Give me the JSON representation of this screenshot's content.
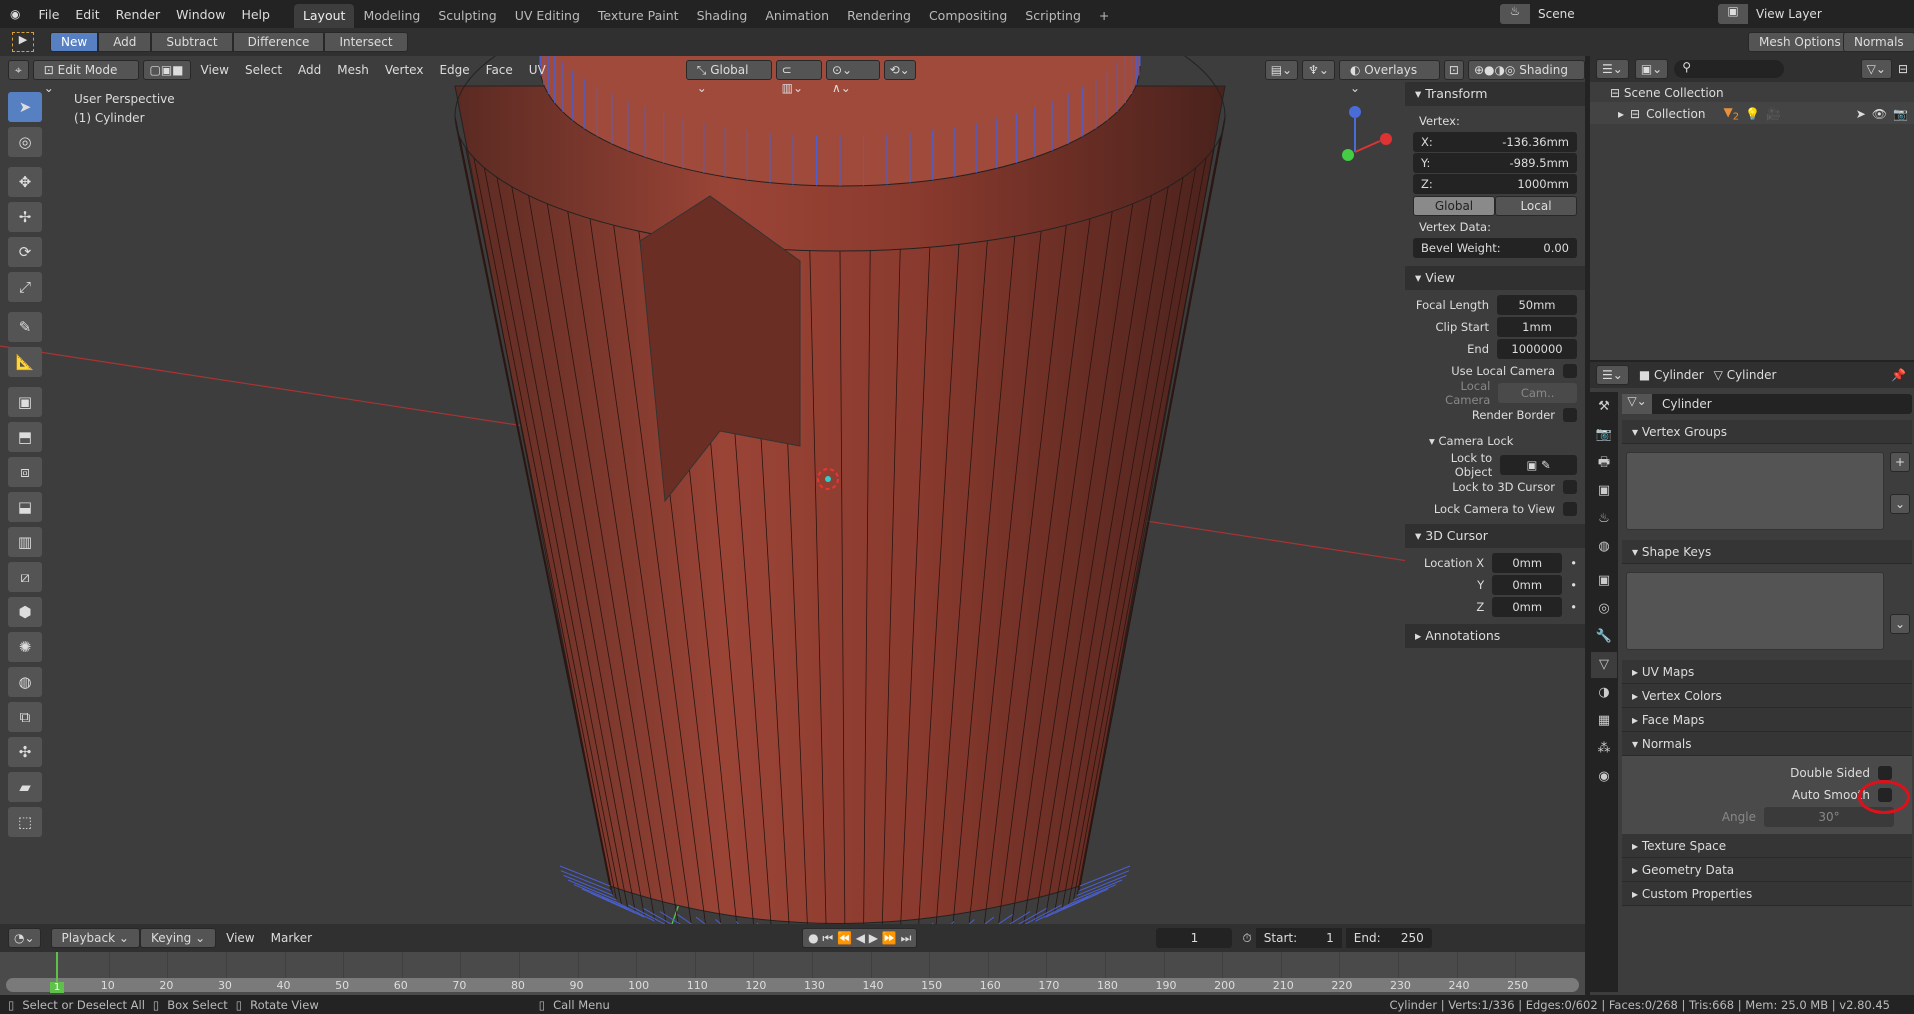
{
  "topbar": {
    "menus": [
      "File",
      "Edit",
      "Render",
      "Window",
      "Help"
    ],
    "workspaces": [
      "Layout",
      "Modeling",
      "Sculpting",
      "UV Editing",
      "Texture Paint",
      "Shading",
      "Animation",
      "Rendering",
      "Compositing",
      "Scripting"
    ],
    "active_workspace": "Layout",
    "add_workspace": "+",
    "scene": "Scene",
    "view_layer": "View Layer"
  },
  "toolbar": {
    "modes": [
      "New",
      "Add",
      "Subtract",
      "Difference",
      "Intersect"
    ],
    "active_mode": "New",
    "mesh_options": "Mesh Options",
    "normals": "Normals"
  },
  "viewport_header": {
    "mode": "Edit Mode",
    "menus": [
      "View",
      "Select",
      "Add",
      "Mesh",
      "Vertex",
      "Edge",
      "Face",
      "UV"
    ],
    "orientation": "Global",
    "overlays": "Overlays",
    "shading": "Shading"
  },
  "viewport": {
    "perspective": "User Perspective",
    "object": "(1) Cylinder",
    "mesh_color": "#8a3a2e",
    "normal_color": "#4a5fd0"
  },
  "npanel": {
    "transform": {
      "title": "Transform",
      "vertex_label": "Vertex:",
      "x_label": "X:",
      "x": "-136.36mm",
      "y_label": "Y:",
      "y": "-989.5mm",
      "z_label": "Z:",
      "z": "1000mm",
      "global": "Global",
      "local": "Local",
      "vertex_data": "Vertex Data:",
      "bevel_label": "Bevel Weight:",
      "bevel": "0.00"
    },
    "view": {
      "title": "View",
      "focal_label": "Focal Length",
      "focal": "50mm",
      "clip_start_label": "Clip Start",
      "clip_start": "1mm",
      "end_label": "End",
      "end": "1000000",
      "use_local_camera": "Use Local Camera",
      "local_camera": "Local Camera",
      "local_camera_value": "Cam..",
      "render_border": "Render Border",
      "camera_lock": "Camera Lock",
      "lock_object": "Lock to Object",
      "lock_cursor": "Lock to 3D Cursor",
      "lock_view": "Lock Camera to View"
    },
    "cursor": {
      "title": "3D Cursor",
      "loc_x_label": "Location X",
      "loc_x": "0mm",
      "y_label": "Y",
      "y": "0mm",
      "z_label": "Z",
      "z": "0mm"
    },
    "annotations": "Annotations"
  },
  "outliner": {
    "scene_collection": "Scene Collection",
    "collection": "Collection",
    "badge": "2"
  },
  "properties": {
    "breadcrumb_object": "Cylinder",
    "breadcrumb_mesh": "Cylinder",
    "mesh_name": "Cylinder",
    "sections": {
      "vertex_groups": "Vertex Groups",
      "shape_keys": "Shape Keys",
      "uv_maps": "UV Maps",
      "vertex_colors": "Vertex Colors",
      "face_maps": "Face Maps",
      "normals": "Normals",
      "texture_space": "Texture Space",
      "geometry_data": "Geometry Data",
      "custom_properties": "Custom Properties"
    },
    "double_sided": "Double Sided",
    "auto_smooth": "Auto Smooth",
    "angle_label": "Angle",
    "angle": "30°",
    "annotation_color": "#e0101a"
  },
  "timeline": {
    "menus": [
      "Playback",
      "Keying",
      "View",
      "Marker"
    ],
    "current_frame": "1",
    "start_label": "Start:",
    "start": "1",
    "end_label": "End:",
    "end": "250",
    "ticks": [
      "10",
      "20",
      "30",
      "40",
      "50",
      "60",
      "70",
      "80",
      "90",
      "100",
      "110",
      "120",
      "130",
      "140",
      "150",
      "160",
      "170",
      "180",
      "190",
      "200",
      "210",
      "220",
      "230",
      "240",
      "250"
    ],
    "frame_marker": "1"
  },
  "status": {
    "hints": [
      "Select or Deselect All",
      "Box Select",
      "Rotate View",
      "Call Menu"
    ],
    "stats": "Cylinder | Verts:1/336 | Edges:0/602 | Faces:0/268 | Tris:668 | Mem: 25.0 MB | v2.80.45"
  }
}
